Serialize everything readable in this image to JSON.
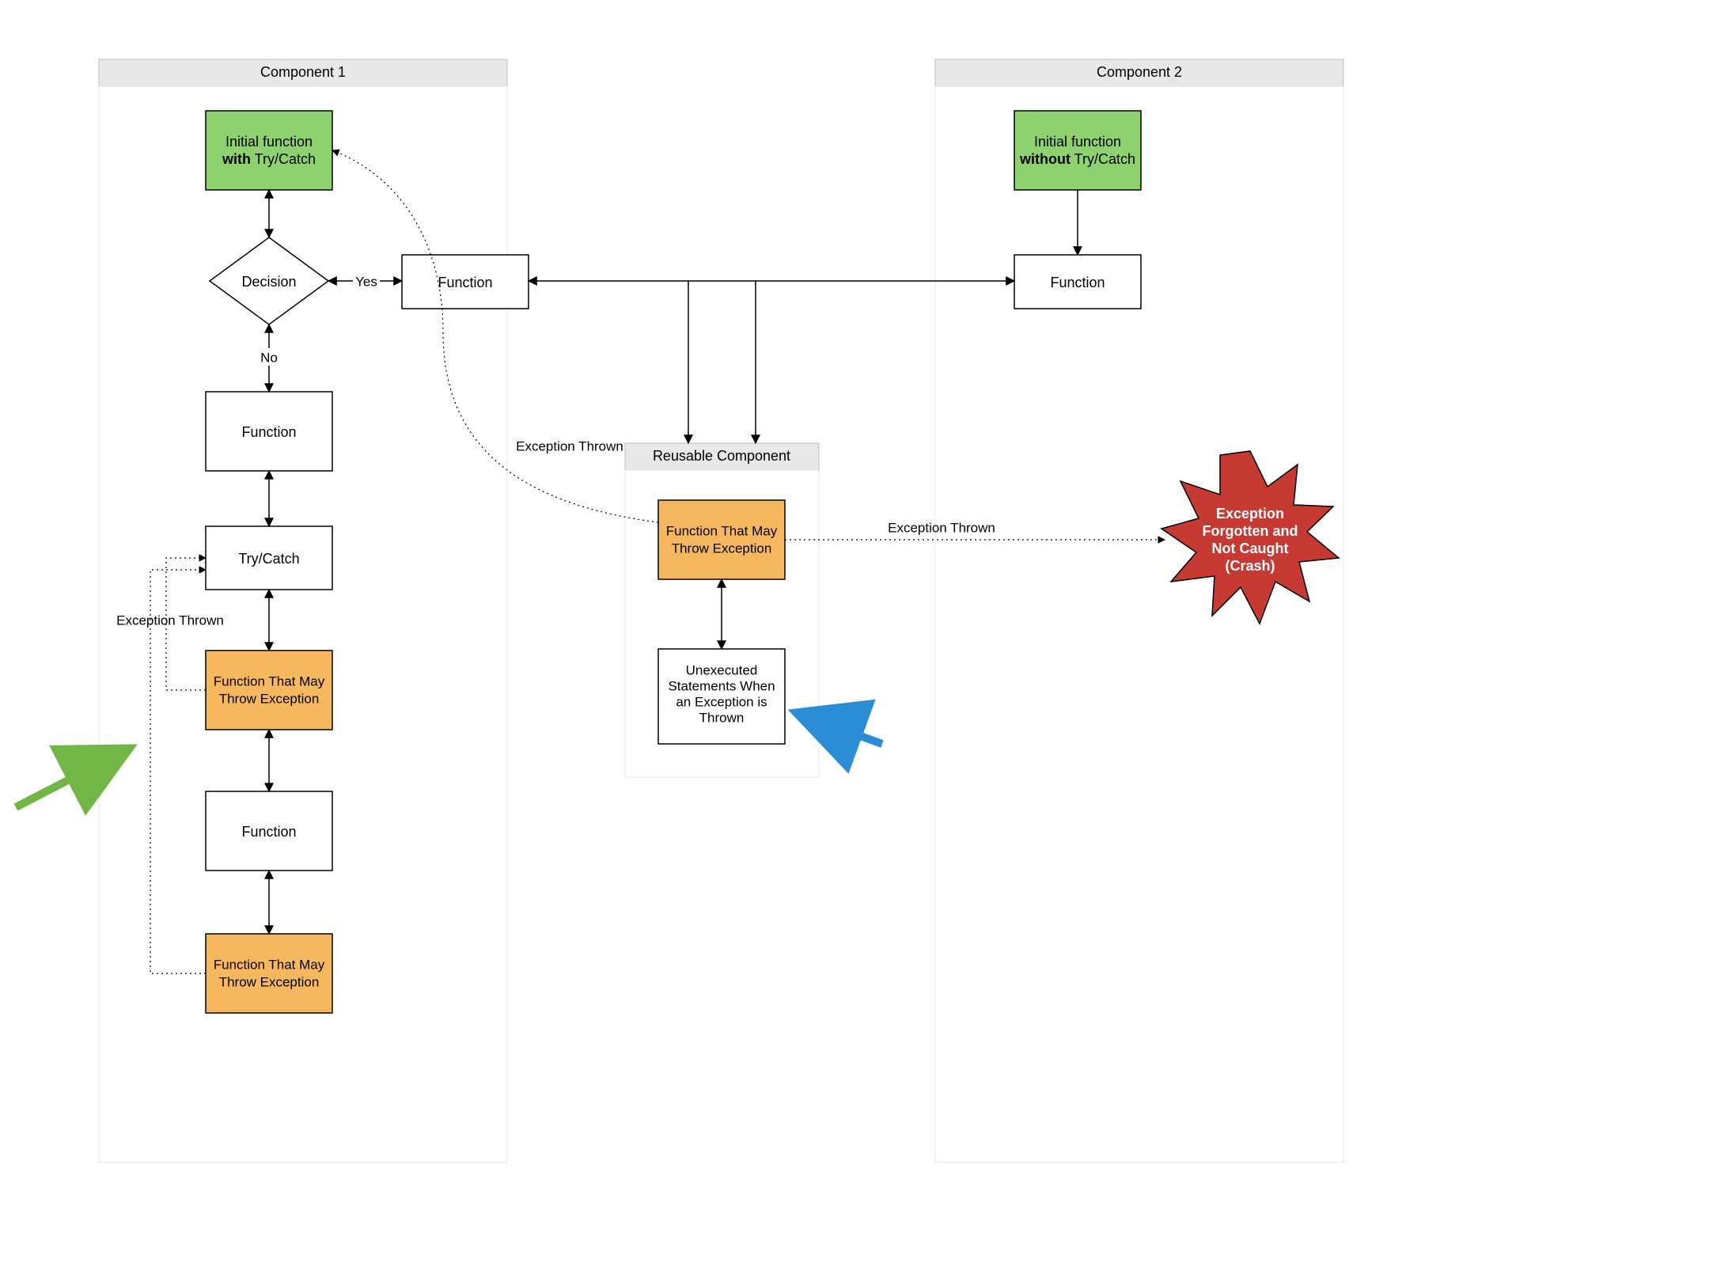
{
  "containers": {
    "c1": {
      "title": "Component 1"
    },
    "c2": {
      "title": "Component 2"
    },
    "reusable": {
      "title": "Reusable Component"
    }
  },
  "nodes": {
    "c1_initial_l1": "Initial function",
    "c1_initial_with": "with",
    "c1_initial_trycatch": " Try/Catch",
    "decision": "Decision",
    "yes": "Yes",
    "no": "No",
    "c1_function_top": "Function",
    "c1_function_mid": "Function",
    "c1_trycatch": "Try/Catch",
    "c1_throw1_l1": "Function That May",
    "c1_throw1_l2": "Throw Exception",
    "c1_function_bot": "Function",
    "c1_throw2_l1": "Function That May",
    "c1_throw2_l2": "Throw Exception",
    "c2_initial_l1": "Initial function",
    "c2_initial_without": "without",
    "c2_initial_trycatch": " Try/Catch",
    "c2_function": "Function",
    "reusable_throw_l1": "Function That May",
    "reusable_throw_l2": "Throw Exception",
    "reusable_unexec_l1": "Unexecuted",
    "reusable_unexec_l2": "Statements When",
    "reusable_unexec_l3": "an Exception is",
    "reusable_unexec_l4": "Thrown",
    "crash_l1": "Exception",
    "crash_l2": "Forgotten and",
    "crash_l3": "Not Caught",
    "crash_l4": "(Crash)"
  },
  "edge_labels": {
    "exception_thrown_left": "Exception Thrown",
    "exception_thrown_mid": "Exception Thrown",
    "exception_thrown_right": "Exception Thrown"
  }
}
